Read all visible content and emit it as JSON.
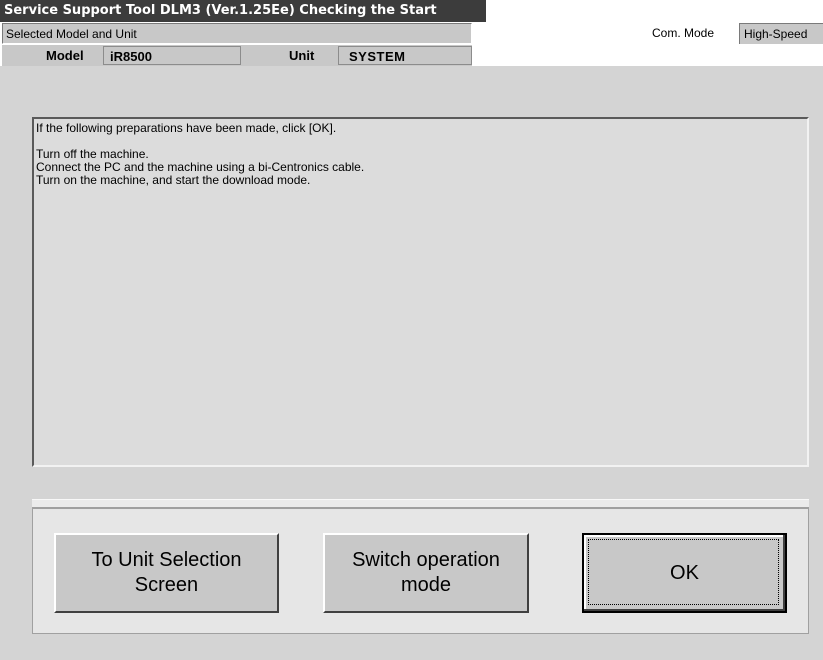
{
  "window": {
    "title": "Service Support Tool DLM3 (Ver.1.25Ee) Checking the Start"
  },
  "header": {
    "selected_label": "Selected Model and Unit",
    "com_mode_label": "Com. Mode",
    "com_mode_value": "High-Speed",
    "model_label": "Model",
    "model_value": "iR8500",
    "unit_label": "Unit",
    "unit_value": "SYSTEM"
  },
  "message": {
    "intro": "If the following preparations have been made, click [OK].",
    "steps": [
      "Turn off the machine.",
      "Connect the PC and the machine using a bi-Centronics cable.",
      "Turn on the machine, and start the download mode."
    ]
  },
  "buttons": {
    "unit_selection_line1": "To Unit Selection",
    "unit_selection_line2": "Screen",
    "switch_mode_line1": "Switch operation",
    "switch_mode_line2": "mode",
    "ok": "OK"
  },
  "colors": {
    "titlebar": "#3c3c3c",
    "window_bg": "#d4d4d4",
    "panel_bg": "#dcdcdc",
    "button_bg": "#c8c8c8"
  }
}
